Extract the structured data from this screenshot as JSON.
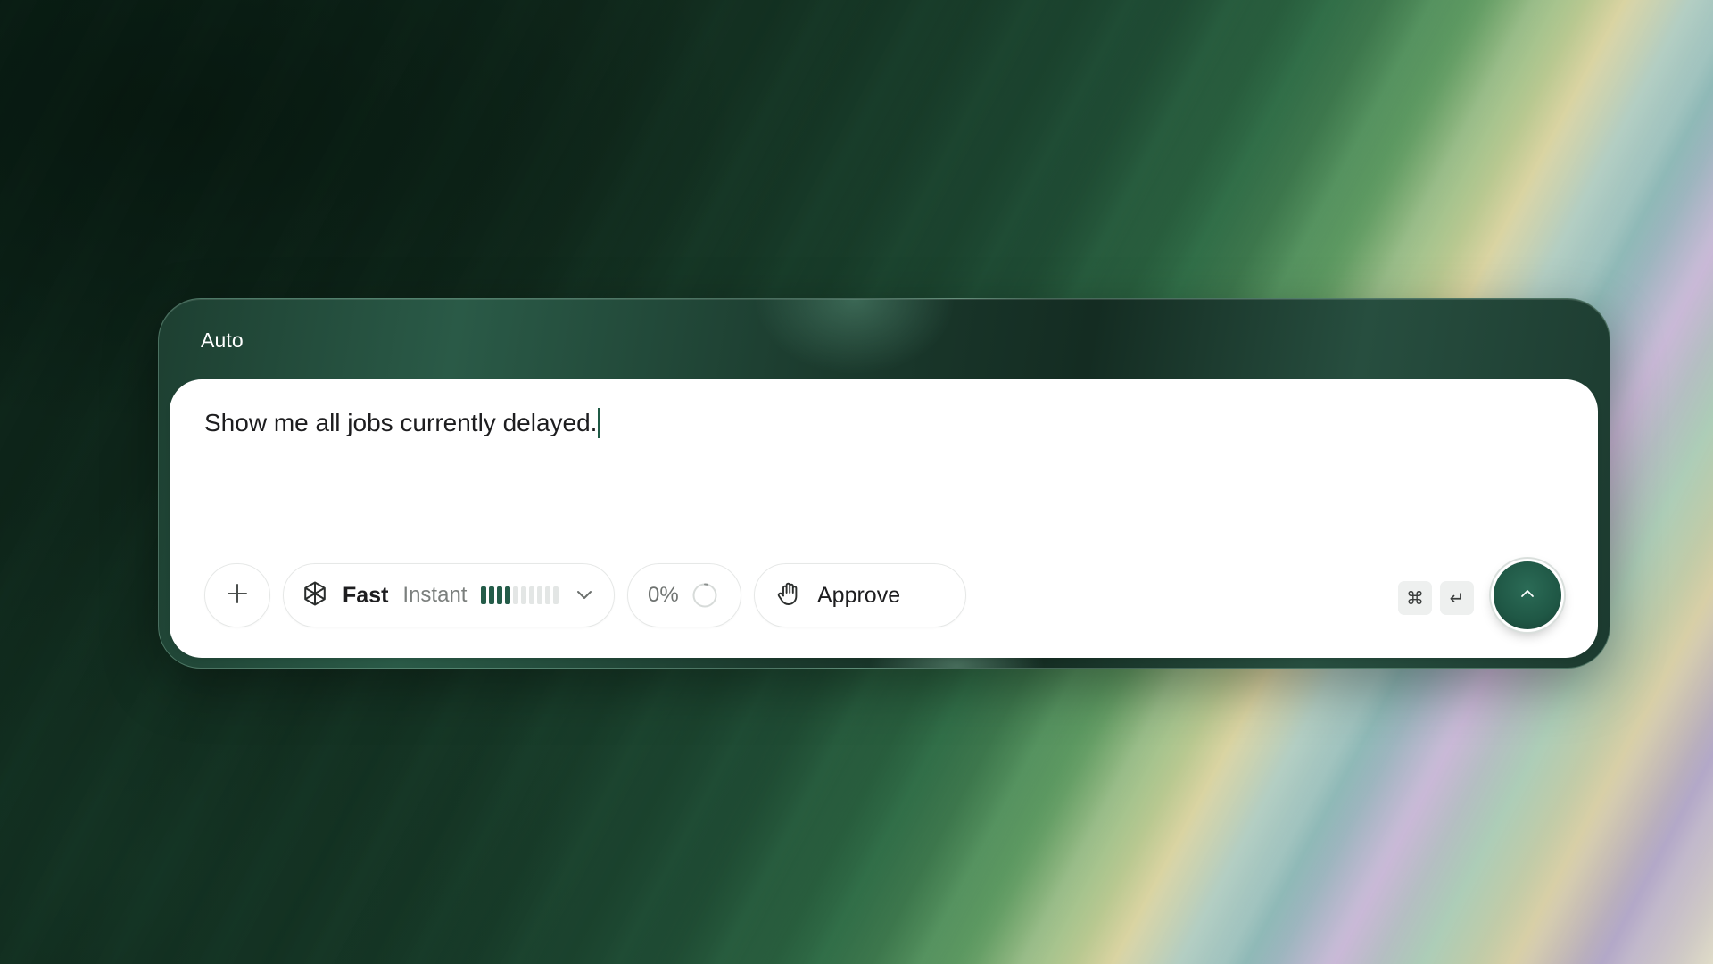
{
  "composer": {
    "mode_label": "Auto",
    "prompt_text": "Show me all jobs currently delayed.",
    "add_icon": "plus-icon",
    "model": {
      "icon": "openai-logo-icon",
      "name": "Fast",
      "speed": "Instant",
      "meter_level": 4,
      "meter_total": 10,
      "dropdown_icon": "chevron-down-icon"
    },
    "progress": {
      "value": "0%",
      "icon": "progress-ring-icon"
    },
    "approval": {
      "icon": "hand-icon",
      "label": "Approve"
    },
    "shortcut": {
      "modifier": "⌘",
      "key": "↵"
    },
    "send_icon": "chevron-up-icon"
  },
  "colors": {
    "accent": "#245c49",
    "send_button": "#1f5745",
    "panel": "#1d3f31"
  }
}
